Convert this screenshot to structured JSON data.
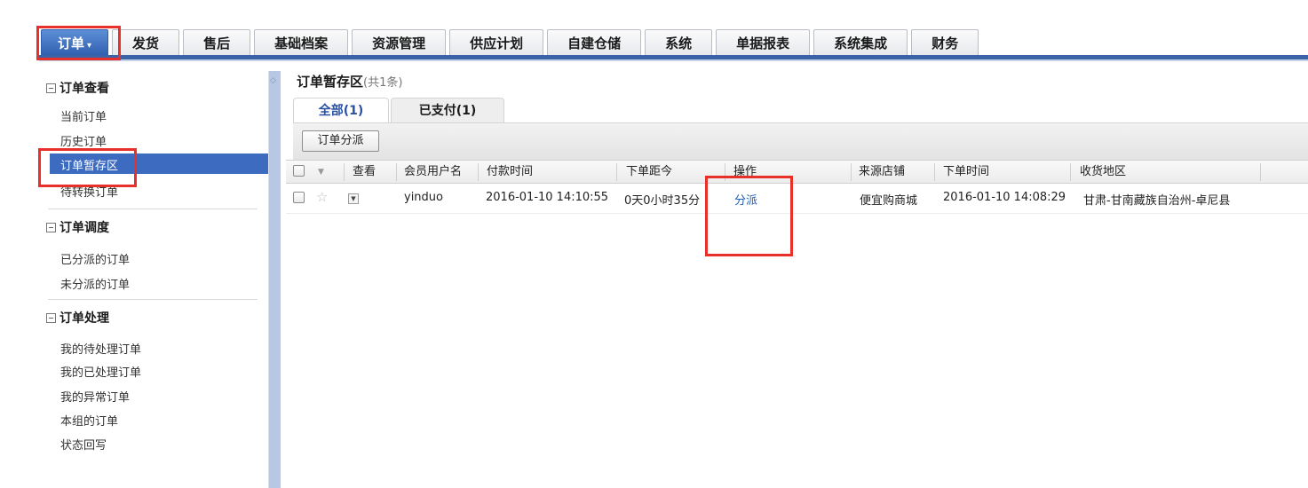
{
  "nav": {
    "tabs": [
      {
        "label": "订单",
        "has_caret": true,
        "active": true
      },
      {
        "label": "发货"
      },
      {
        "label": "售后"
      },
      {
        "label": "基础档案"
      },
      {
        "label": "资源管理"
      },
      {
        "label": "供应计划"
      },
      {
        "label": "自建仓储"
      },
      {
        "label": "系统"
      },
      {
        "label": "单据报表"
      },
      {
        "label": "系统集成"
      },
      {
        "label": "财务"
      }
    ],
    "caret": "▾"
  },
  "sidebar": {
    "groups": [
      {
        "title": "订单查看",
        "items": [
          "当前订单",
          "历史订单",
          "订单暂存区",
          "待转换订单"
        ]
      },
      {
        "title": "订单调度",
        "items": [
          "已分派的订单",
          "未分派的订单"
        ]
      },
      {
        "title": "订单处理",
        "items": [
          "我的待处理订单",
          "我的已处理订单",
          "我的异常订单",
          "本组的订单",
          "状态回写"
        ]
      }
    ],
    "collapse_icon": "◇",
    "selected_item": "订单暂存区"
  },
  "main": {
    "title": "订单暂存区",
    "count_text": "(共1条)",
    "subtabs": {
      "all": "全部(1)",
      "paid": "已支付(1)"
    },
    "toolbar": {
      "dispatch_button": "订单分派"
    },
    "grid": {
      "headers": [
        "查看",
        "会员用户名",
        "付款时间",
        "下单距今",
        "操作",
        "来源店铺",
        "下单时间",
        "收货地区"
      ],
      "rows": [
        {
          "username": "yinduo",
          "pay_time": "2016-01-10 14:10:55",
          "elapsed": "0天0小时35分",
          "action": "分派",
          "shop": "便宜购商城",
          "order_time": "2016-01-10 14:08:29",
          "region": "甘肃-甘南藏族自治州-卓尼县"
        }
      ]
    }
  },
  "colors": {
    "accent": "#3b64a8",
    "selected": "#3d6bc0",
    "link": "#1f5fb6",
    "annotation": "#e8302a"
  }
}
